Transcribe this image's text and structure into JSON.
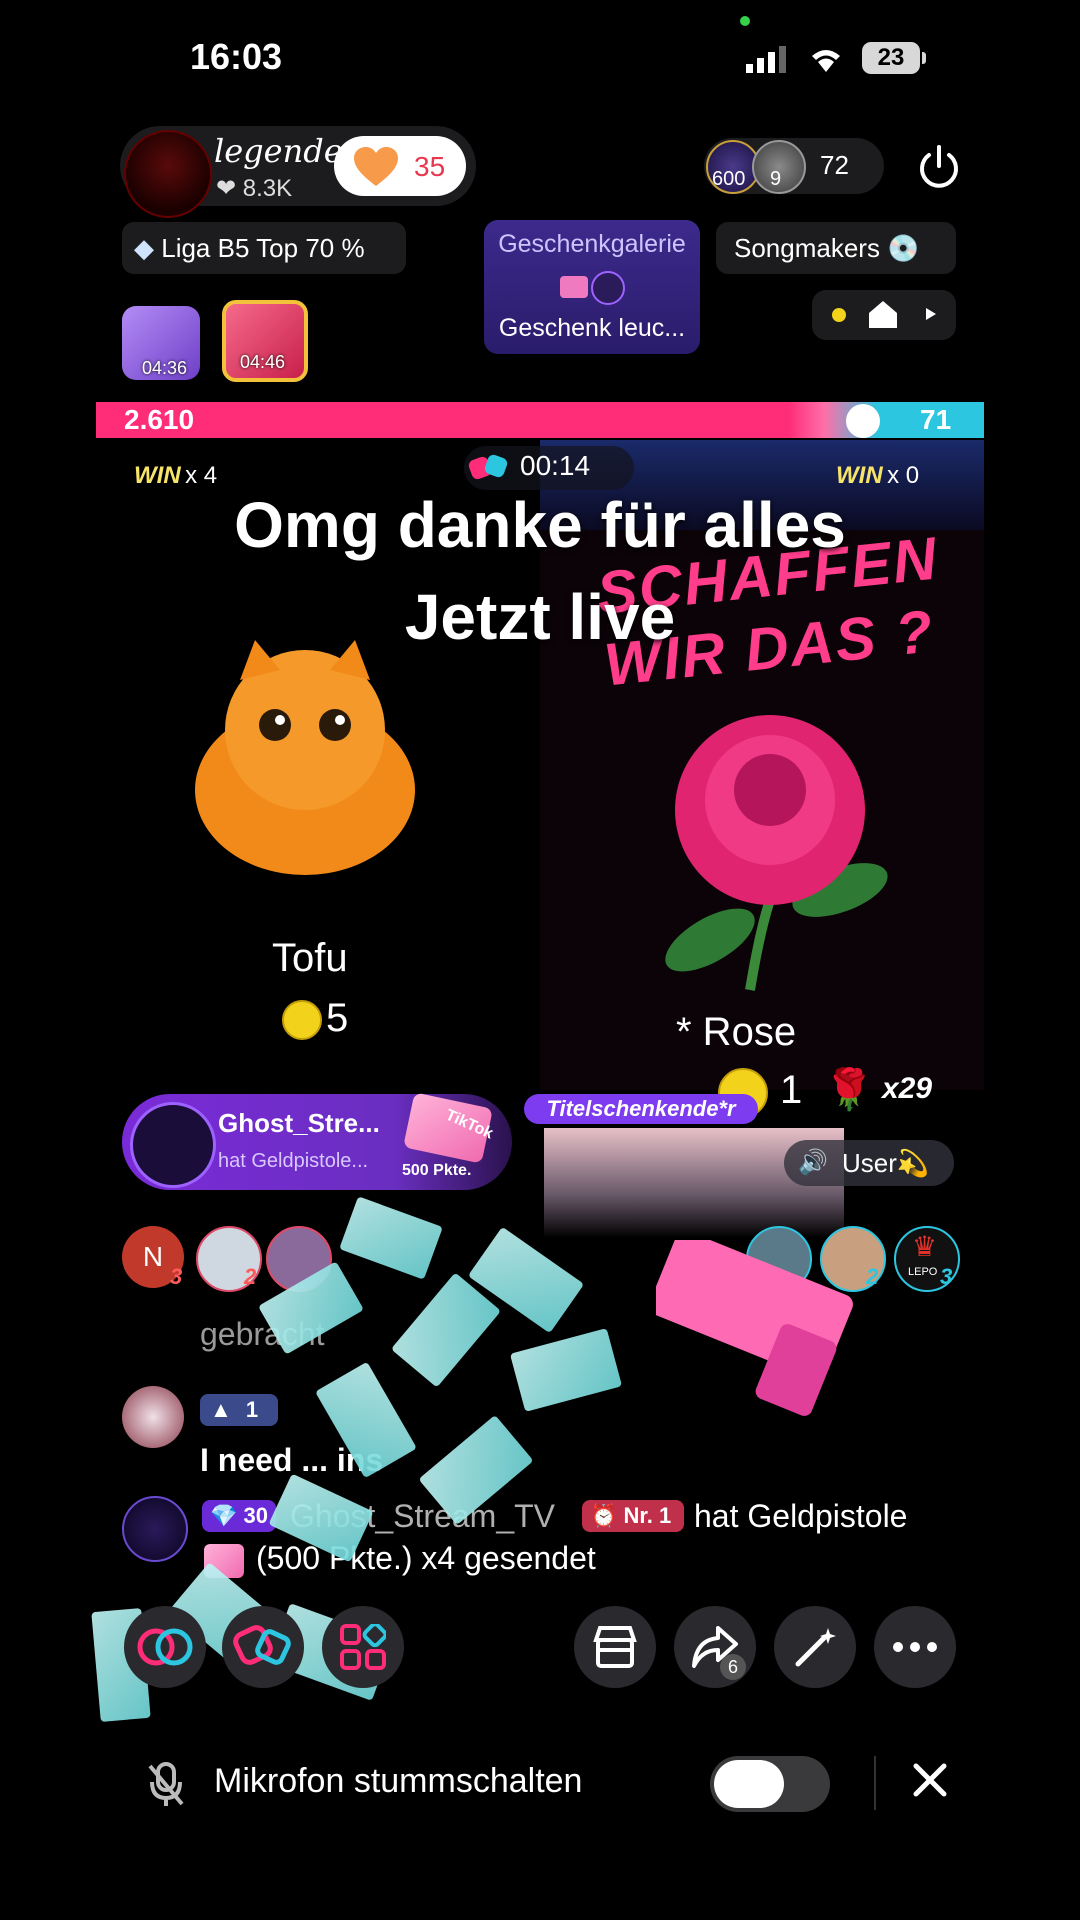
{
  "status_bar": {
    "time": "16:03",
    "battery": "23"
  },
  "host": {
    "name": "legende",
    "likes": "8.3K",
    "follow_count": "35"
  },
  "viewers": {
    "badge1": "600",
    "badge2": "9",
    "count": "72"
  },
  "tags": {
    "league": "Liga B5 Top 70 %",
    "songmakers": "Songmakers"
  },
  "gift_gallery": {
    "title": "Geschenkgalerie",
    "subtitle": "Geschenk leuc..."
  },
  "chests": [
    {
      "timer": "04:36"
    },
    {
      "timer": "04:46"
    }
  ],
  "battle": {
    "score_left": "2.610",
    "score_right": "71",
    "win_left": "WIN",
    "win_left_x": "x 4",
    "win_right": "WIN",
    "win_right_x": "x 0",
    "timer": "00:14",
    "overlay_line1": "Omg danke für alles",
    "overlay_line2": "Jetzt live",
    "rose_banner": "SCHAFFEN\nWIR DAS ?",
    "left_name": "Tofu",
    "left_coins": "5",
    "right_name": "* Rose",
    "right_coins": "1",
    "right_multiplier": "x29"
  },
  "gift_banner": {
    "user": "Ghost_Stre...",
    "action": "hat Geldpistole...",
    "points": "500 Pkte.",
    "gift_label": "TikTok"
  },
  "title_tag": "Titelschenkende*r",
  "user_pill": "User💫",
  "ranking_avatars": [
    {
      "letter": "N",
      "rank": "3"
    },
    {
      "rank": "2"
    },
    {
      "rank": "2"
    },
    {
      "rank": "3",
      "label": "LEPO"
    }
  ],
  "chat": [
    {
      "text": "gebracht"
    },
    {
      "badge": "1",
      "text": "I need ... ins"
    },
    {
      "badge": "30",
      "user": "Ghost_Stream_TV",
      "rank": "Nr. 1",
      "text1": "hat Geldpistole",
      "text2": "(500 Pkte.) x4 gesendet"
    }
  ],
  "share_count": "6",
  "mic_bar": {
    "label": "Mikrofon stummschalten"
  },
  "colors": {
    "accent_pink": "#ff2d78",
    "accent_cyan": "#2cc6e0",
    "gallery_purple": "#3d2a8c"
  }
}
